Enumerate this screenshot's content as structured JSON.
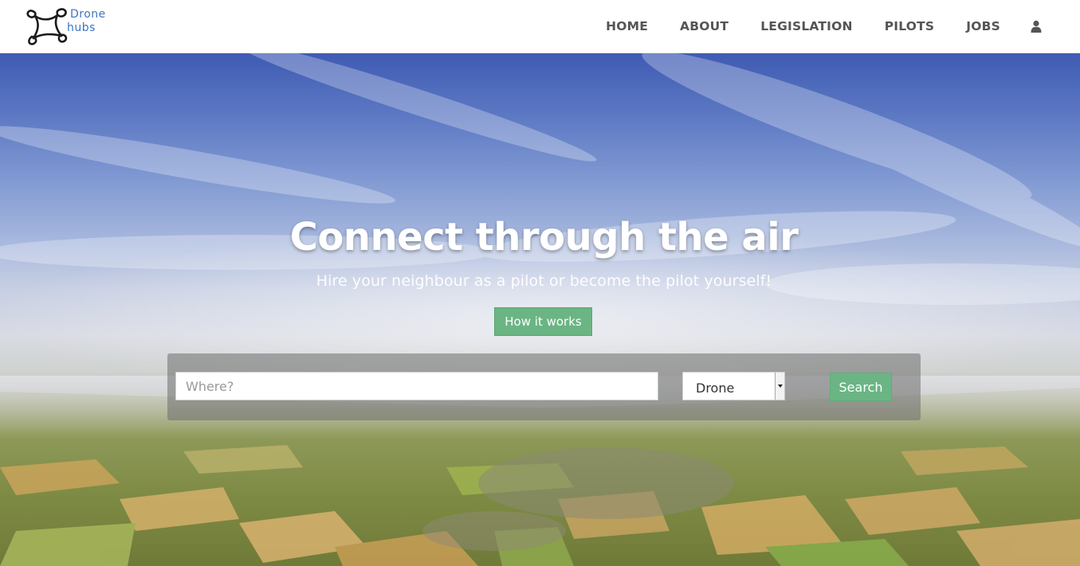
{
  "brand": {
    "line1": "Drone",
    "line2": "hubs",
    "logo_icon": "drone-icon",
    "color": "#3f74c4"
  },
  "nav": {
    "items": [
      {
        "label": "HOME"
      },
      {
        "label": "ABOUT"
      },
      {
        "label": "LEGISLATION"
      },
      {
        "label": "PILOTS"
      },
      {
        "label": "JOBS"
      }
    ],
    "user_icon": "user-icon"
  },
  "hero": {
    "title": "Connect through the air",
    "subtitle": "Hire your neighbour as a pilot or become the pilot yourself!",
    "how_button": "How it works",
    "background": "aerial-landscape-sky"
  },
  "search": {
    "where_placeholder": "Where?",
    "where_value": "",
    "type_selected": "Drone",
    "button": "Search"
  },
  "colors": {
    "accent": "#6ab583",
    "nav_text": "#555555",
    "brand": "#3f74c4"
  }
}
